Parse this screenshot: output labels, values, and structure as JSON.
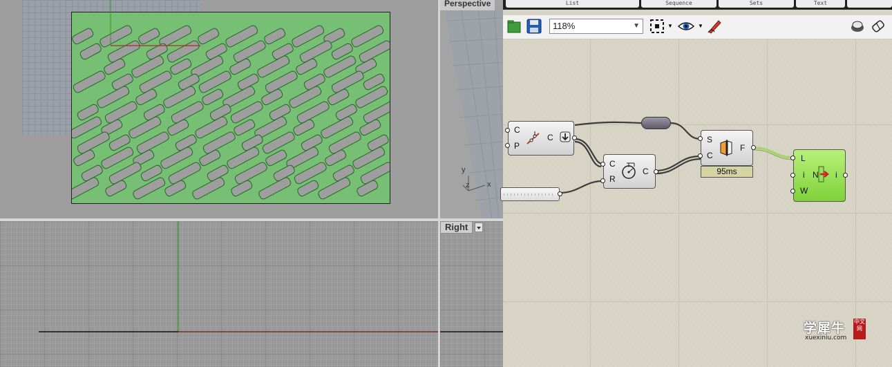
{
  "viewports": {
    "perspective_label": "Perspective",
    "right_label": "Right",
    "right_dropdown_icon": "triangle-down-icon",
    "axes": {
      "x": "x",
      "y": "y",
      "z": "z"
    }
  },
  "grasshopper": {
    "tabs": [
      "List",
      "Sequence",
      "Sets",
      "Text"
    ],
    "toolbar": {
      "zoom_value": "118%",
      "icons": [
        "open-file-icon",
        "save-icon",
        "zoom-extents-icon",
        "preview-eye-icon",
        "sketch-pen-icon",
        "display-mode-icon",
        "eraser-icon"
      ]
    },
    "components": {
      "c1": {
        "inputs": [
          "C",
          "P"
        ],
        "output": "C"
      },
      "c2": {
        "inputs": [
          "C",
          "R"
        ],
        "output": "C"
      },
      "c3": {
        "inputs": [
          "S",
          "C"
        ],
        "output": "F",
        "timer": "95ms"
      },
      "c4": {
        "inputs": [
          "L",
          "i",
          "W"
        ],
        "output": "i",
        "center_label": "N"
      }
    },
    "colors": {
      "canvas": "#d6d2c4",
      "green_component": "#8fe04a",
      "wire": "#3c3c3c",
      "selected_wire": "#a6d26a"
    }
  },
  "watermark": {
    "main": "学犀牛",
    "sub": "xuexiniu.com",
    "seal": "中文网"
  }
}
